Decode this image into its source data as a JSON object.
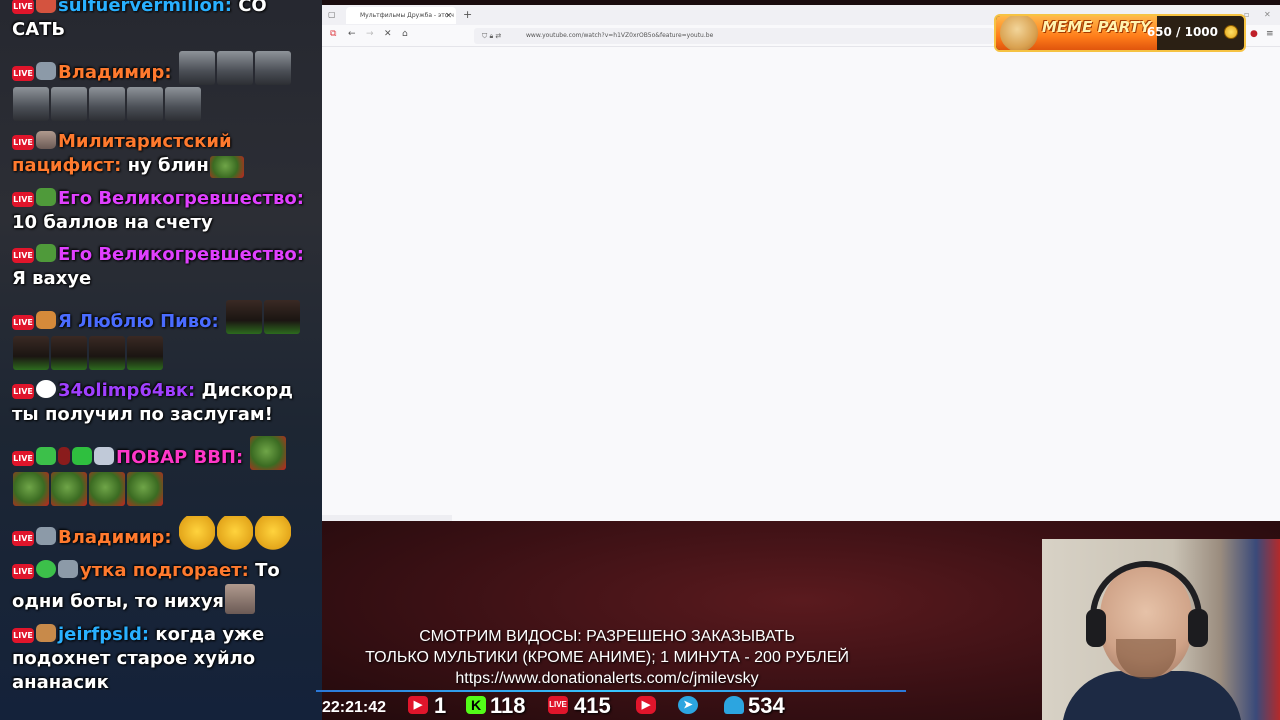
{
  "chat": {
    "badge_live": "LIVE",
    "messages": [
      {
        "name": "sulfuervermilion:",
        "text": "СО САТЬ"
      },
      {
        "name": "Владимир:",
        "text": ""
      },
      {
        "name": "Милитаристский пацифист:",
        "text": "ну блин"
      },
      {
        "name": "Его Великогревшество:",
        "text": "10 баллов на счету"
      },
      {
        "name": "Его Великогревшество:",
        "text": "Я вахуе"
      },
      {
        "name": "Я Люблю Пиво:",
        "text": ""
      },
      {
        "name": "34olimp64вк:",
        "text": "Дискорд ты получил по заслугам!"
      },
      {
        "name": "ПОВАР ВВП:",
        "text": ""
      },
      {
        "name": "Владимир:",
        "text": ""
      },
      {
        "name": "утка подгорает:",
        "text": "То одни боты, то нихуя"
      },
      {
        "name": "jeirfpsld:",
        "text": "когда уже подохнет старое хуйло ананасик"
      }
    ]
  },
  "browser": {
    "tab_title": "Мультфильмы Дружба - это ч",
    "url": "www.youtube.com/watch?v=h1VZ0xrOB5o&feature=youtu.be"
  },
  "meme_party": {
    "title": "MEME PARTY",
    "count": "650 / 1000",
    "progress": 0.65
  },
  "notice": {
    "line1": "СМОТРИМ ВИДОСЫ: РАЗРЕШЕНО ЗАКАЗЫВАТЬ",
    "line2": "ТОЛЬКО МУЛЬТИКИ (КРОМЕ АНИМЕ); 1 МИНУТА - 200 РУБЛЕЙ",
    "line3": "https://www.donationalerts.com/c/jmilevsky"
  },
  "stats": {
    "time": "22:21:42",
    "youtube": "1",
    "kick": "118",
    "vk_live": "415",
    "telegram": "534"
  }
}
